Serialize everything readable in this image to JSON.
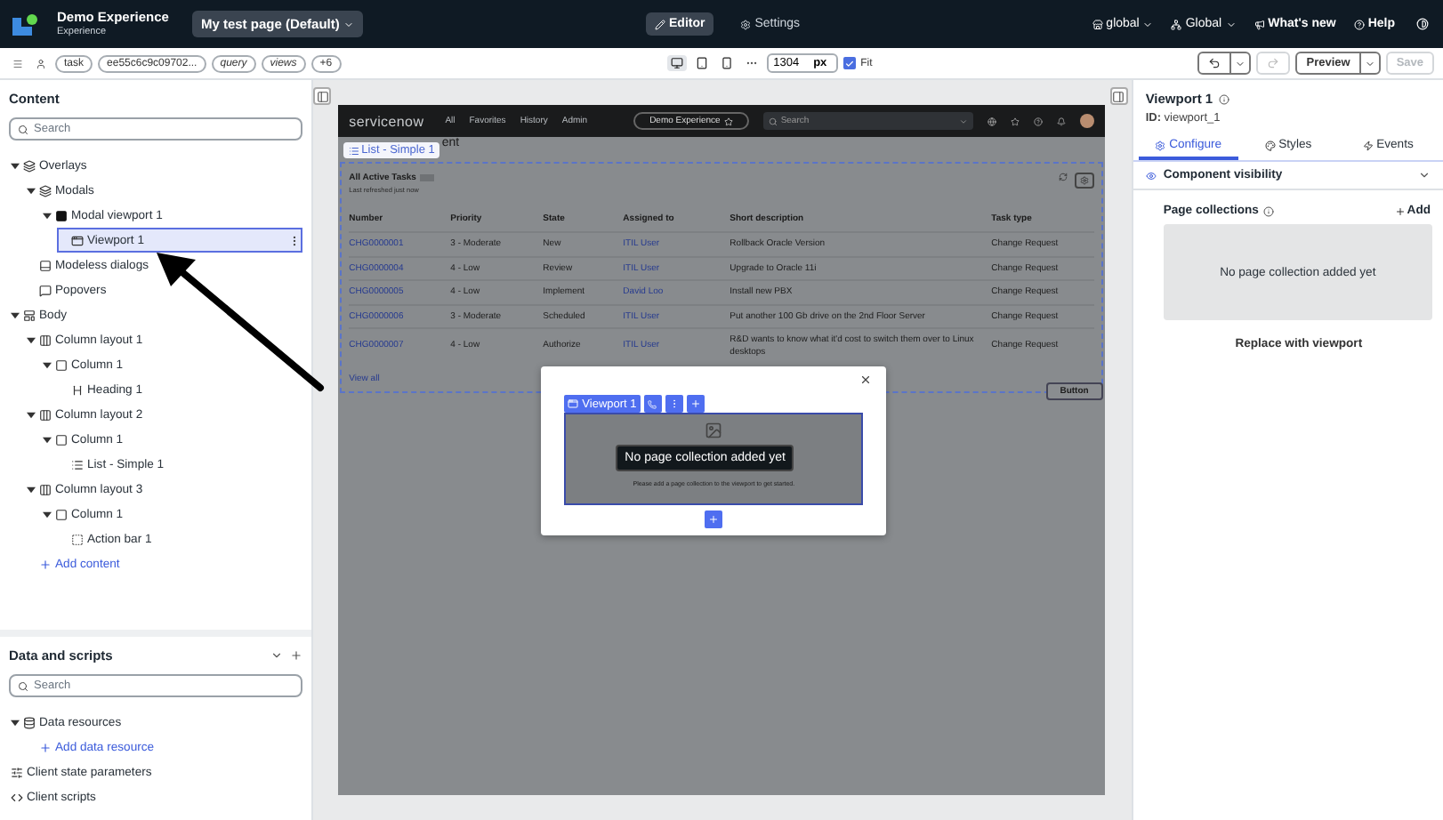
{
  "app_bar": {
    "app_name": "Demo Experience",
    "app_type": "Experience",
    "page_selector": "My test page (Default)",
    "modes": [
      {
        "label": "Editor",
        "kind": "editor",
        "selected": true
      },
      {
        "label": "Settings",
        "kind": "settings",
        "selected": false
      }
    ],
    "scope": "global",
    "application": "Global",
    "links": [
      {
        "label": "What's new",
        "kind": "news"
      },
      {
        "label": "Help",
        "kind": "help"
      }
    ]
  },
  "toolbar": {
    "chips": [
      {
        "label": "task",
        "italic": false
      },
      {
        "label": "ee55c6c9c09702...",
        "italic": false
      },
      {
        "label": "query",
        "italic": true
      },
      {
        "label": "views",
        "italic": true
      },
      {
        "label": "+6",
        "italic": false
      }
    ],
    "devices": [
      {
        "kind": "desktop",
        "selected": true
      },
      {
        "kind": "tablet",
        "selected": false
      },
      {
        "kind": "mobile",
        "selected": false
      }
    ],
    "width_value": "1304",
    "width_unit": "px",
    "fit": {
      "label": "Fit",
      "checked": true
    },
    "undo_disabled": false,
    "redo_disabled": true,
    "preview": "Preview",
    "save": {
      "label": "Save",
      "disabled": true
    }
  },
  "content_panel": {
    "title": "Content",
    "search_placeholder": "Search",
    "tree": [
      {
        "label": "Overlays",
        "kind": "overlay",
        "expanded": true,
        "selected": false,
        "children": [
          {
            "label": "Modals",
            "kind": "overlay",
            "expanded": true,
            "selected": false,
            "children": [
              {
                "label": "Modal viewport 1",
                "kind": "modal",
                "expanded": true,
                "selected": false,
                "children": [
                  {
                    "label": "Viewport 1",
                    "kind": "viewport",
                    "selected": true
                  }
                ]
              }
            ]
          },
          {
            "label": "Modeless dialogs",
            "kind": "dialog",
            "selected": false
          },
          {
            "label": "Popovers",
            "kind": "popover",
            "selected": false
          }
        ]
      },
      {
        "label": "Body",
        "kind": "body",
        "expanded": true,
        "selected": false,
        "children": [
          {
            "label": "Column layout 1",
            "kind": "layout",
            "expanded": true,
            "selected": false,
            "children": [
              {
                "label": "Column 1",
                "kind": "column",
                "expanded": true,
                "selected": false,
                "children": [
                  {
                    "label": "Heading 1",
                    "kind": "heading",
                    "selected": false
                  }
                ]
              }
            ]
          },
          {
            "label": "Column layout 2",
            "kind": "layout",
            "expanded": true,
            "selected": false,
            "children": [
              {
                "label": "Column 1",
                "kind": "column",
                "expanded": true,
                "selected": false,
                "children": [
                  {
                    "label": "List - Simple 1",
                    "kind": "list",
                    "selected": false
                  }
                ]
              }
            ]
          },
          {
            "label": "Column layout 3",
            "kind": "layout",
            "expanded": true,
            "selected": false,
            "children": [
              {
                "label": "Column 1",
                "kind": "column",
                "expanded": true,
                "selected": false,
                "children": [
                  {
                    "label": "Action bar 1",
                    "kind": "actionbar",
                    "selected": false
                  }
                ]
              }
            ]
          },
          {
            "label": "Add content",
            "kind": "add",
            "selected": false
          }
        ]
      }
    ]
  },
  "data_panel": {
    "title": "Data and scripts",
    "search_placeholder": "Search",
    "items": [
      {
        "label": "Data resources",
        "kind": "resources",
        "expanded": true,
        "children": [
          {
            "label": "Add data resource",
            "kind": "add"
          }
        ]
      },
      {
        "label": "Client state parameters",
        "kind": "state"
      },
      {
        "label": "Client scripts",
        "kind": "scripts"
      }
    ]
  },
  "preview": {
    "logo": "servicenow",
    "nav": [
      "All",
      "Favorites",
      "History",
      "Admin"
    ],
    "experience": "Demo Experience",
    "search_placeholder": "Search",
    "list_label": "List - Simple 1",
    "heading_fragment": "ent",
    "card": {
      "title": "All Active Tasks",
      "subtitle": "Last refreshed just now",
      "columns": [
        "Number",
        "Priority",
        "State",
        "Assigned to",
        "Short description",
        "Task type"
      ],
      "rows": [
        [
          "CHG0000001",
          "3 - Moderate",
          "New",
          "ITIL User",
          "Rollback Oracle Version",
          "Change Request"
        ],
        [
          "CHG0000004",
          "4 - Low",
          "Review",
          "ITIL User",
          "Upgrade to Oracle 11i",
          "Change Request"
        ],
        [
          "CHG0000005",
          "4 - Low",
          "Implement",
          "David Loo",
          "Install new PBX",
          "Change Request"
        ],
        [
          "CHG0000006",
          "3 - Moderate",
          "Scheduled",
          "ITIL User",
          "Put another 100 Gb drive on the 2nd Floor Server",
          "Change Request"
        ],
        [
          "CHG0000007",
          "4 - Low",
          "Authorize",
          "ITIL User",
          "R&D wants to know what it'd cost to switch them over to Linux desktops",
          "Change Request"
        ]
      ],
      "view_all": "View all"
    },
    "button": "Button",
    "modal": {
      "chip": "Viewport 1",
      "tooltip": "No page collection added yet",
      "hint": "Please add a page collection to the viewport to get started."
    }
  },
  "properties": {
    "title": "Viewport 1",
    "id_label": "ID:",
    "id": "viewport_1",
    "tabs": [
      {
        "label": "Configure",
        "kind": "configure",
        "selected": true
      },
      {
        "label": "Styles",
        "kind": "styles",
        "selected": false
      },
      {
        "label": "Events",
        "kind": "events",
        "selected": false
      }
    ],
    "visibility": {
      "label": "Component visibility",
      "expanded": false
    },
    "collections": {
      "label": "Page collections",
      "add": "Add",
      "empty": "No page collection added yet"
    },
    "replace": "Replace with viewport"
  }
}
